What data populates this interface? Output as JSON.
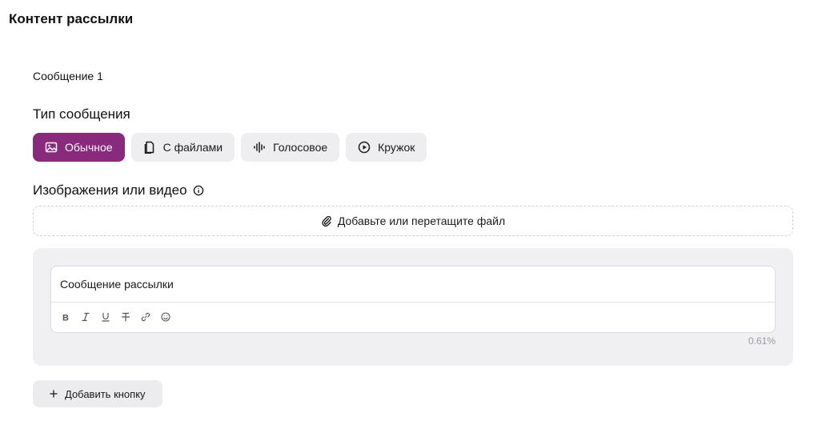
{
  "header": {
    "title": "Контент рассылки"
  },
  "message": {
    "label": "Сообщение 1",
    "type_heading": "Тип сообщения",
    "types": [
      {
        "label": "Обычное",
        "icon": "image-icon",
        "active": true
      },
      {
        "label": "С файлами",
        "icon": "file-icon",
        "active": false
      },
      {
        "label": "Голосовое",
        "icon": "waveform-icon",
        "active": false
      },
      {
        "label": "Кружок",
        "icon": "play-circle-icon",
        "active": false
      }
    ],
    "media_heading": "Изображения или видео",
    "upload_label": "Добавьте или перетащите файл"
  },
  "editor": {
    "text": "Сообщение рассылки",
    "toolbar": [
      "bold-icon",
      "italic-icon",
      "underline-icon",
      "strikethrough-icon",
      "link-icon",
      "emoji-icon"
    ],
    "char_count": "0.61%"
  },
  "add_button_label": "Добавить кнопку",
  "colors": {
    "accent": "#8a2a7d",
    "tab_bg": "#eeeef0",
    "panel_bg": "#f0f0f2"
  }
}
